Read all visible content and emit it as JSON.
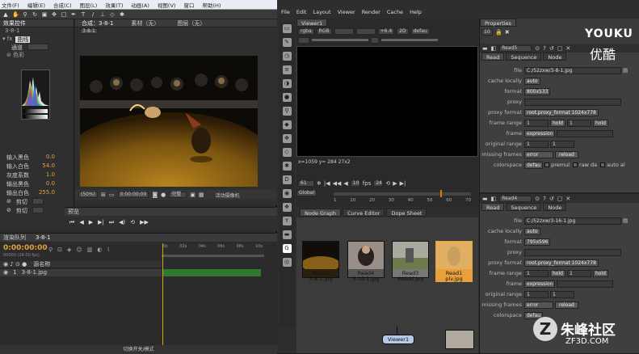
{
  "ae": {
    "menu": [
      "文件(F)",
      "编辑(E)",
      "合成(C)",
      "图层(L)",
      "效果(T)",
      "动画(A)",
      "视图(V)",
      "窗口",
      "帮助(H)"
    ],
    "project_tab": "效果控件",
    "project_item": "3-8-1",
    "layer_name": "3-8-1.jpg",
    "fx_name": "曲线",
    "fx_channel": "通道",
    "fx_sub": "⊘ 色彩",
    "fx_params": [
      {
        "name": "输入黑色",
        "val": "0.0"
      },
      {
        "name": "输入白色",
        "val": "54.0"
      },
      {
        "name": "灰度系数",
        "val": "1.0"
      },
      {
        "name": "输出黑色",
        "val": "0.0"
      },
      {
        "name": "输出白色",
        "val": "255.0"
      }
    ],
    "fx_clip1": "剪切",
    "fx_clip2": "剪切",
    "comp_tab": "合成：3-8-1",
    "layer_tab": "素材（无）",
    "footage_tab": "图层（无）",
    "comp_crumb": "3-8-1",
    "comp_zoom": "(50%)",
    "comp_time": "0:00:00:00",
    "comp_res": "完整",
    "preview_tab": "预览",
    "timeline_tab": "渲染队列",
    "timeline_comp": "3-8-1",
    "timecode": "0:00:00:00",
    "fps": "00000 (24.00 fps)",
    "col_source": "源名称",
    "layer_row": "1",
    "layer_file": "3-8-1.jpg",
    "ruler": [
      "0s",
      "02s",
      "04s",
      "06s",
      "08s",
      "10s"
    ],
    "footer": "切换开关/模式"
  },
  "nuke": {
    "menu": [
      "File",
      "Edit",
      "Layout",
      "Viewer",
      "Render",
      "Cache",
      "Help"
    ],
    "viewer_tab": "Viewer1",
    "channel": "rgba",
    "chan2": "RGB",
    "gain": "+6.4",
    "view": "2D",
    "proxy": "defau",
    "coords": "x=1059 y= 284   27x2",
    "frame": "61",
    "fps": "24",
    "frame_end": "76",
    "global": "Global",
    "ticks": [
      "1",
      "10",
      "20",
      "30",
      "40",
      "50",
      "60",
      "70"
    ],
    "graph_tabs": [
      "Node Graph",
      "Curve Editor",
      "Dope Sheet"
    ],
    "nodes": [
      {
        "name": "Read5",
        "file": "3-8-1.jpg"
      },
      {
        "name": "Read4",
        "file": "3-16-1.jpg"
      },
      {
        "name": "Read3",
        "file": "ddddd.jpg"
      },
      {
        "name": "Read1",
        "file": "plv.jpg"
      }
    ],
    "viewer_node": "Viewer1",
    "props_tab": "Properties",
    "props_count": "10",
    "panels": [
      {
        "name": "Read5",
        "tabs": [
          "Read",
          "Sequence",
          "Node"
        ],
        "file": "C:/52zxw/3-8-1.jpg",
        "cache": "auto",
        "format": "800x533",
        "proxy_format": "root.proxy_format 1024x778",
        "fr1": "1",
        "fr_mode": "hold",
        "fr2": "1",
        "fr_mode2": "hold",
        "frame_mode": "expression",
        "orig1": "1",
        "orig2": "1",
        "missing": "error",
        "reload": "reload",
        "colorspace": "defau",
        "premul": "premul",
        "rawdata": "raw da",
        "autoal": "auto al"
      },
      {
        "name": "Read4",
        "tabs": [
          "Read",
          "Sequence",
          "Node"
        ],
        "file": "C:/52zxw/3-16-1.jpg",
        "cache": "auto",
        "format": "795x596",
        "proxy_format": "root.proxy_format 1024x778",
        "fr1": "1",
        "fr_mode": "hold",
        "fr2": "1",
        "fr_mode2": "hold",
        "frame_mode": "expression",
        "orig1": "1",
        "orig2": "1",
        "missing": "error",
        "reload": "reload",
        "colorspace": "defau"
      }
    ],
    "labels": {
      "file": "file",
      "cache": "cache locally",
      "format": "format",
      "proxy": "proxy",
      "proxy_format": "proxy format",
      "frame_range": "frame range",
      "frame": "frame",
      "orig": "original range",
      "missing": "missing frames",
      "colorspace": "colorspace"
    }
  },
  "watermark": {
    "youku1": "YOUKU",
    "youku2": "优酷",
    "zf1": "朱峰社区",
    "zf2": "ZF3D.COM"
  }
}
